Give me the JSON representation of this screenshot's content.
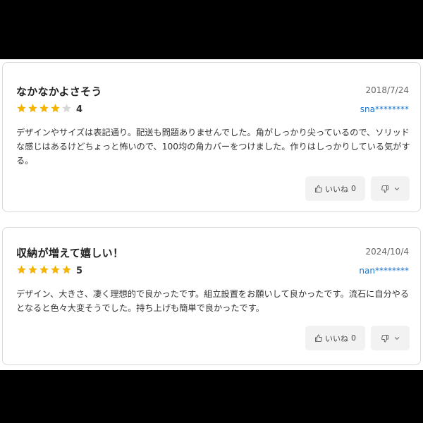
{
  "colors": {
    "star_filled": "#f5b400",
    "star_empty": "#d6d6d6",
    "reviewer_link": "#1a73c8"
  },
  "reviews": [
    {
      "title": "なかなかよさそう",
      "date": "2018/7/24",
      "rating": 4,
      "rating_max": 5,
      "rating_label": "4",
      "reviewer": "sna********",
      "body": "デザインやサイズは表記通り。配送も問題ありませんでした。角がしっかり尖っているので、ソリッドな感じはあるけどちょっと怖いので、100均の角カバーをつけました。作りはしっかりしている気がする。",
      "like_label": "いいね",
      "like_count": "0",
      "like_icon": "thumbs-up-icon",
      "dislike_icon": "thumbs-down-icon"
    },
    {
      "title": "収納が増えて嬉しい！",
      "date": "2024/10/4",
      "rating": 5,
      "rating_max": 5,
      "rating_label": "5",
      "reviewer": "nan********",
      "body": "デザイン、大きさ、凄く理想的で良かったです。組立設置をお願いして良かったです。流石に自分やるとなると色々大変そうでした。持ち上げも簡単で良かったです。",
      "like_label": "いいね",
      "like_count": "0",
      "like_icon": "thumbs-up-icon",
      "dislike_icon": "thumbs-down-icon"
    }
  ]
}
